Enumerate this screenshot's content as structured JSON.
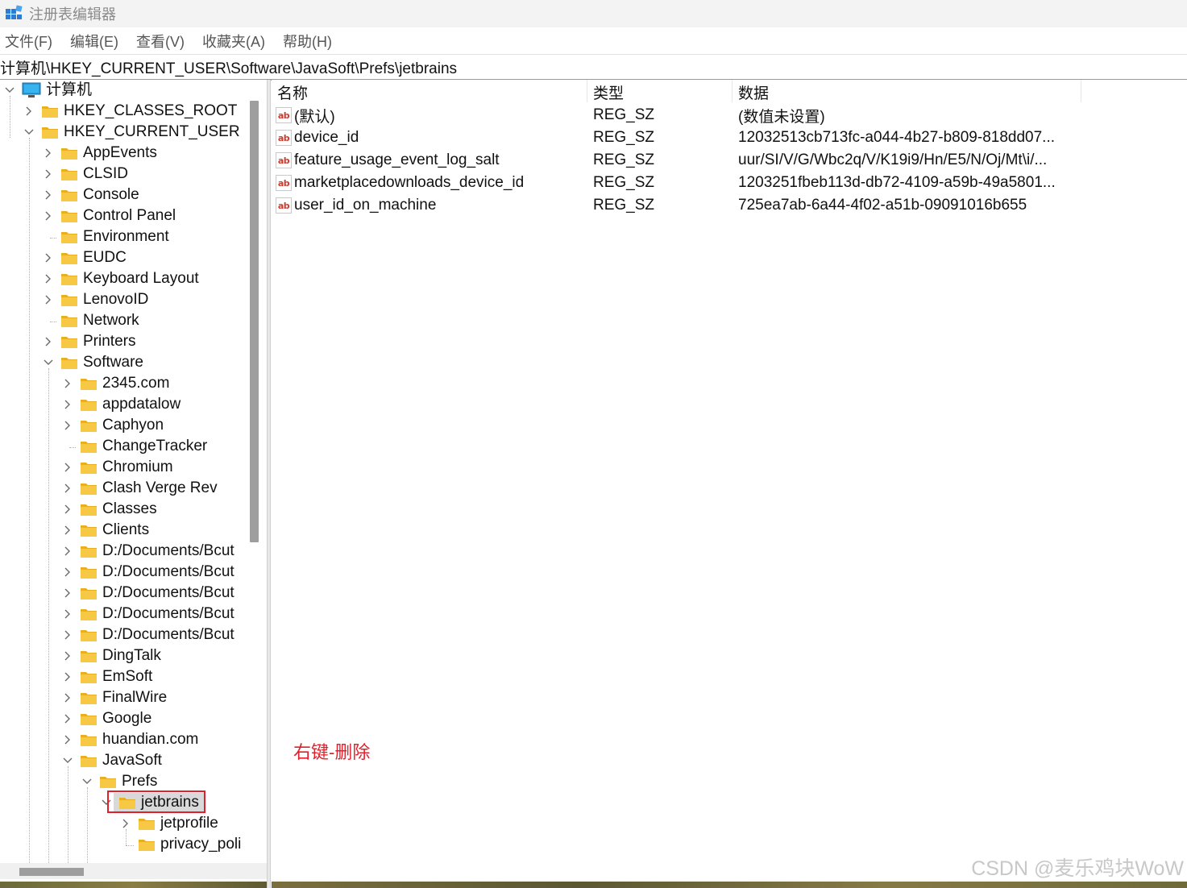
{
  "window": {
    "title": "注册表编辑器"
  },
  "menu": [
    "文件(F)",
    "编辑(E)",
    "查看(V)",
    "收藏夹(A)",
    "帮助(H)"
  ],
  "address": "计算机\\HKEY_CURRENT_USER\\Software\\JavaSoft\\Prefs\\jetbrains",
  "tree": [
    {
      "label": "计算机",
      "level": 0,
      "expander": "expanded",
      "icon": "computer-icon"
    },
    {
      "label": "HKEY_CLASSES_ROOT",
      "level": 1,
      "expander": "collapsed"
    },
    {
      "label": "HKEY_CURRENT_USER",
      "level": 1,
      "expander": "expanded"
    },
    {
      "label": "AppEvents",
      "level": 2,
      "expander": "collapsed"
    },
    {
      "label": "CLSID",
      "level": 2,
      "expander": "collapsed"
    },
    {
      "label": "Console",
      "level": 2,
      "expander": "collapsed"
    },
    {
      "label": "Control Panel",
      "level": 2,
      "expander": "collapsed"
    },
    {
      "label": "Environment",
      "level": 2,
      "expander": "none"
    },
    {
      "label": "EUDC",
      "level": 2,
      "expander": "collapsed"
    },
    {
      "label": "Keyboard Layout",
      "level": 2,
      "expander": "collapsed"
    },
    {
      "label": "LenovoID",
      "level": 2,
      "expander": "collapsed"
    },
    {
      "label": "Network",
      "level": 2,
      "expander": "none"
    },
    {
      "label": "Printers",
      "level": 2,
      "expander": "collapsed"
    },
    {
      "label": "Software",
      "level": 2,
      "expander": "expanded"
    },
    {
      "label": "2345.com",
      "level": 3,
      "expander": "collapsed"
    },
    {
      "label": "appdatalow",
      "level": 3,
      "expander": "collapsed"
    },
    {
      "label": "Caphyon",
      "level": 3,
      "expander": "collapsed"
    },
    {
      "label": "ChangeTracker",
      "level": 3,
      "expander": "none"
    },
    {
      "label": "Chromium",
      "level": 3,
      "expander": "collapsed"
    },
    {
      "label": "Clash Verge Rev",
      "level": 3,
      "expander": "collapsed"
    },
    {
      "label": "Classes",
      "level": 3,
      "expander": "collapsed"
    },
    {
      "label": "Clients",
      "level": 3,
      "expander": "collapsed"
    },
    {
      "label": "D:/Documents/Bcut",
      "level": 3,
      "expander": "collapsed"
    },
    {
      "label": "D:/Documents/Bcut",
      "level": 3,
      "expander": "collapsed"
    },
    {
      "label": "D:/Documents/Bcut",
      "level": 3,
      "expander": "collapsed"
    },
    {
      "label": "D:/Documents/Bcut",
      "level": 3,
      "expander": "collapsed"
    },
    {
      "label": "D:/Documents/Bcut",
      "level": 3,
      "expander": "collapsed"
    },
    {
      "label": "DingTalk",
      "level": 3,
      "expander": "collapsed"
    },
    {
      "label": "EmSoft",
      "level": 3,
      "expander": "collapsed"
    },
    {
      "label": "FinalWire",
      "level": 3,
      "expander": "collapsed"
    },
    {
      "label": "Google",
      "level": 3,
      "expander": "collapsed"
    },
    {
      "label": "huandian.com",
      "level": 3,
      "expander": "collapsed"
    },
    {
      "label": "JavaSoft",
      "level": 3,
      "expander": "expanded"
    },
    {
      "label": "Prefs",
      "level": 4,
      "expander": "expanded"
    },
    {
      "label": "jetbrains",
      "level": 5,
      "expander": "expanded",
      "selected": true
    },
    {
      "label": "jetprofile",
      "level": 6,
      "expander": "collapsed"
    },
    {
      "label": "privacy_poli",
      "level": 6,
      "expander": "none"
    }
  ],
  "list": {
    "columns": [
      "名称",
      "类型",
      "数据"
    ],
    "rows": [
      {
        "name": "(默认)",
        "type": "REG_SZ",
        "data": "(数值未设置)"
      },
      {
        "name": "device_id",
        "type": "REG_SZ",
        "data": "12032513cb713fc-a044-4b27-b809-818dd07..."
      },
      {
        "name": "feature_usage_event_log_salt",
        "type": "REG_SZ",
        "data": "uur/SI/V/G/Wbc2q/V/K19i9/Hn/E5/N/Oj/Mt\\i/..."
      },
      {
        "name": "marketplacedownloads_device_id",
        "type": "REG_SZ",
        "data": "1203251fbeb113d-db72-4109-a59b-49a5801..."
      },
      {
        "name": "user_id_on_machine",
        "type": "REG_SZ",
        "data": "725ea7ab-6a44-4f02-a51b-09091016b655"
      }
    ]
  },
  "annotation": "右键-删除",
  "watermark": "CSDN @麦乐鸡块WoW",
  "colors": {
    "highlight": "#e0212b",
    "folder": "#f7c843",
    "selected": "#d9d9d9"
  }
}
